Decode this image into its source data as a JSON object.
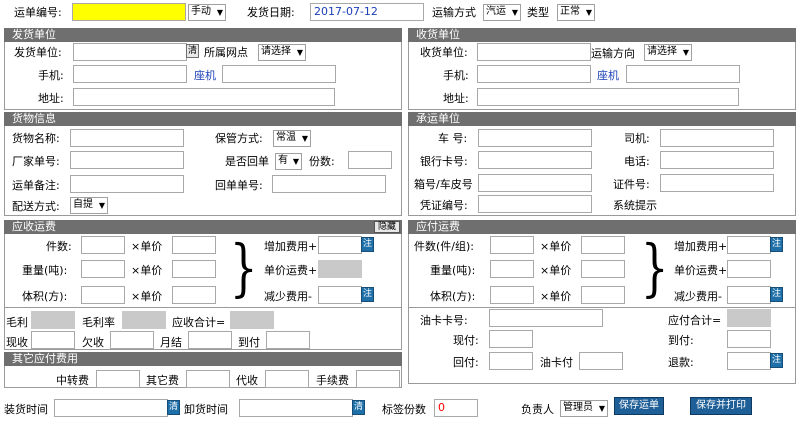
{
  "top": {
    "waybill_no_label": "运单编号:",
    "waybill_no_value": "",
    "mode_select": "手动",
    "ship_date_label": "发货日期:",
    "ship_date_value": "2017-07-12",
    "transport_label": "运输方式",
    "transport_select": "汽运",
    "type_label": "类型",
    "type_select": "正常"
  },
  "sender": {
    "header": "发货单位",
    "unit_label": "发货单位:",
    "network_label": "所属网点",
    "network_select": "请选择",
    "mobile_label": "手机:",
    "landline_label": "座机",
    "address_label": "地址:"
  },
  "receiver": {
    "header": "收货单位",
    "unit_label": "收货单位:",
    "direction_label": "运输方向",
    "direction_select": "请选择",
    "mobile_label": "手机:",
    "landline_label": "座机",
    "address_label": "地址:"
  },
  "goods": {
    "header": "货物信息",
    "name_label": "货物名称:",
    "storage_label": "保管方式:",
    "storage_select": "常温",
    "factory_no_label": "厂家单号:",
    "return_label": "是否回单",
    "return_select": "有",
    "copies_label": "份数:",
    "remark_label": "运单备注:",
    "return_no_label": "回单单号:",
    "delivery_label": "配送方式:",
    "delivery_select": "自提"
  },
  "carrier": {
    "header": "承运单位",
    "plate_label": "车  号:",
    "driver_label": "司机:",
    "bank_label": "银行卡号:",
    "phone_label": "电话:",
    "box_label": "箱号/车皮号",
    "id_label": "证件号:",
    "voucher_label": "凭证编号:",
    "prompt_label": "系统提示"
  },
  "receivable": {
    "header": "应收运费",
    "hide_button": "隐藏",
    "count_label": "件数:",
    "weight_label": "重量(吨):",
    "volume_label": "体积(方):",
    "times_unit": "×单价",
    "add_fee_label": "增加费用+",
    "unit_fee_label": "单价运费+",
    "reduce_fee_label": "减少费用-",
    "note_button": "注",
    "profit_label": "毛利",
    "profit_rate_label": "毛利率",
    "total_label": "应收合计=",
    "cash_label": "现收",
    "owed_label": "欠收",
    "monthly_label": "月结",
    "cod_label": "到付"
  },
  "payable": {
    "header": "应付运费",
    "count_label": "件数(件/组):",
    "weight_label": "重量(吨):",
    "volume_label": "体积(方):",
    "times_unit": "×单价",
    "add_fee_label": "增加费用+",
    "unit_fee_label": "单价运费+",
    "reduce_fee_label": "减少费用-",
    "note_button": "注",
    "oil_card_label": "油卡卡号:",
    "total_label": "应付合计=",
    "cash_label": "现付:",
    "cod_label": "到付:",
    "return_pay_label": "回付:",
    "oil_pay_label": "油卡付",
    "refund_label": "退款:"
  },
  "other": {
    "header": "其它应付费用",
    "transfer_label": "中转费",
    "other_label": "其它费",
    "collect_label": "代收",
    "handling_label": "手续费"
  },
  "bottom": {
    "load_time_label": "装货时间",
    "unload_time_label": "卸货时间",
    "label_copies_label": "标签份数",
    "label_copies_value": "0",
    "manager_label": "负责人",
    "manager_select": "管理员",
    "save_button": "保存运单",
    "save_print_button": "保存并打印",
    "calendar_icon_text": "清"
  },
  "colors": {
    "required_field": "#ffff00",
    "section_header": "#6f6f6f",
    "disabled_field": "#c9c9c9",
    "button": "#1f5f97",
    "link": "#1a3fb8",
    "date_text": "#1a3fb8",
    "count_text": "#ff0000"
  }
}
